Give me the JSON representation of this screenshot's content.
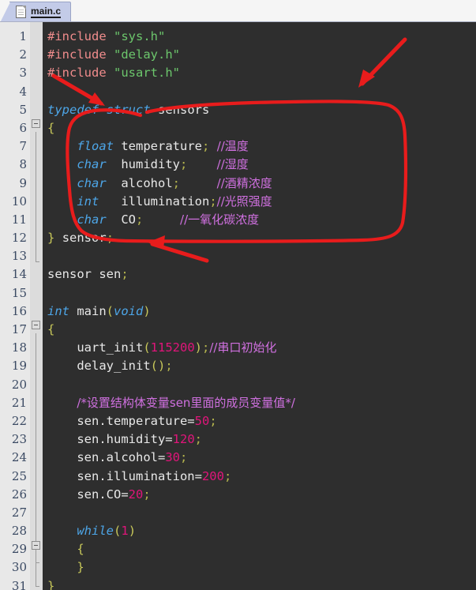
{
  "window": {
    "title": "main.c"
  },
  "tab": {
    "label": "main.c",
    "icon": "document-icon"
  },
  "editor": {
    "background_color": "#2e2e2e",
    "gutter_color": "#e8e8e8",
    "line_number_color": "#3b4a63",
    "first_line": 1,
    "last_line": 31,
    "total_lines": 31,
    "line_numbers": [
      1,
      2,
      3,
      4,
      5,
      6,
      7,
      8,
      9,
      10,
      11,
      12,
      13,
      14,
      15,
      16,
      17,
      18,
      19,
      20,
      21,
      22,
      23,
      24,
      25,
      26,
      27,
      28,
      29,
      30,
      31
    ]
  },
  "syntax_colors": {
    "preprocessor": "#f08c8c",
    "string": "#6cc66c",
    "keyword": "#4da6e8",
    "identifier": "#e8e8e8",
    "number": "#e0157a",
    "comment": "#d070e0",
    "punctuation": "#c8c85a",
    "annotation_red": "#e81c1c"
  },
  "code": {
    "lines": [
      {
        "n": 1,
        "text": "#include \"sys.h\""
      },
      {
        "n": 2,
        "text": "#include \"delay.h\""
      },
      {
        "n": 3,
        "text": "#include \"usart.h\""
      },
      {
        "n": 4,
        "text": ""
      },
      {
        "n": 5,
        "text": "typedef struct sensors"
      },
      {
        "n": 6,
        "text": "{"
      },
      {
        "n": 7,
        "text": "    float temperature; //温度"
      },
      {
        "n": 8,
        "text": "    char  humidity;    //湿度"
      },
      {
        "n": 9,
        "text": "    char  alcohol;     //酒精浓度"
      },
      {
        "n": 10,
        "text": "    int   illumination;//光照强度"
      },
      {
        "n": 11,
        "text": "    char  CO;     //一氧化碳浓度"
      },
      {
        "n": 12,
        "text": "} sensor;"
      },
      {
        "n": 13,
        "text": ""
      },
      {
        "n": 14,
        "text": "sensor sen;"
      },
      {
        "n": 15,
        "text": ""
      },
      {
        "n": 16,
        "text": "int main(void)"
      },
      {
        "n": 17,
        "text": "{"
      },
      {
        "n": 18,
        "text": "    uart_init(115200);//串口初始化"
      },
      {
        "n": 19,
        "text": "    delay_init();"
      },
      {
        "n": 20,
        "text": ""
      },
      {
        "n": 21,
        "text": "    /*设置结构体变量sen里面的成员变量值*/"
      },
      {
        "n": 22,
        "text": "    sen.temperature=50;"
      },
      {
        "n": 23,
        "text": "    sen.humidity=120;"
      },
      {
        "n": 24,
        "text": "    sen.alcohol=30;"
      },
      {
        "n": 25,
        "text": "    sen.illumination=200;"
      },
      {
        "n": 26,
        "text": "    sen.CO=20;"
      },
      {
        "n": 27,
        "text": ""
      },
      {
        "n": 28,
        "text": "    while(1)"
      },
      {
        "n": 29,
        "text": "    {"
      },
      {
        "n": 30,
        "text": "    }"
      },
      {
        "n": 31,
        "text": "}"
      }
    ],
    "tokens": {
      "include": "#include",
      "str_sys": "\"sys.h\"",
      "str_delay": "\"delay.h\"",
      "str_usart": "\"usart.h\"",
      "kw_typedef": "typedef",
      "kw_struct": "struct",
      "tag_sensors": "sensors",
      "brace_open": "{",
      "brace_close": "}",
      "kw_float": "float",
      "kw_char": "char",
      "kw_int": "int",
      "kw_while": "while",
      "kw_void": "void",
      "m_temperature": "temperature",
      "m_humidity": "humidity",
      "m_alcohol": "alcohol",
      "m_illumination": "illumination",
      "m_co": "CO",
      "semi": ";",
      "typedef_name": "sensor",
      "var_decl": "sensor sen;",
      "fn_main": "main",
      "fn_uart_init": "uart_init",
      "fn_delay_init": "delay_init",
      "num_115200": "115200",
      "num_1": "1",
      "cmt_temperature": "//温度",
      "cmt_humidity": "//湿度",
      "cmt_alcohol": "//酒精浓度",
      "cmt_illumination": "//光照强度",
      "cmt_co": "//一氧化碳浓度",
      "cmt_uart": "//串口初始化",
      "cmt_block": "/*设置结构体变量sen里面的成员变量值*/",
      "asg_temperature_lhs": "sen.temperature=",
      "asg_temperature_val": "50",
      "asg_humidity_lhs": "sen.humidity=",
      "asg_humidity_val": "120",
      "asg_alcohol_lhs": "sen.alcohol=",
      "asg_alcohol_val": "30",
      "asg_illumination_lhs": "sen.illumination=",
      "asg_illumination_val": "200",
      "asg_co_lhs": "sen.CO=",
      "asg_co_val": "20",
      "paren_open": "(",
      "paren_close": ")",
      "parens_empty": "()"
    }
  },
  "annotations": {
    "color": "#e81c1c",
    "items": [
      {
        "name": "arrow-to-typedef",
        "type": "arrow",
        "target": "typedef keyword on line 5"
      },
      {
        "name": "arrow-to-struct-body",
        "type": "arrow",
        "target": "struct body top-right"
      },
      {
        "name": "arrow-to-sensor-typedef-name",
        "type": "arrow",
        "target": "sensor; on line 12"
      },
      {
        "name": "circle-around-struct",
        "type": "ellipse",
        "target": "struct definition lines 5-12"
      }
    ]
  }
}
